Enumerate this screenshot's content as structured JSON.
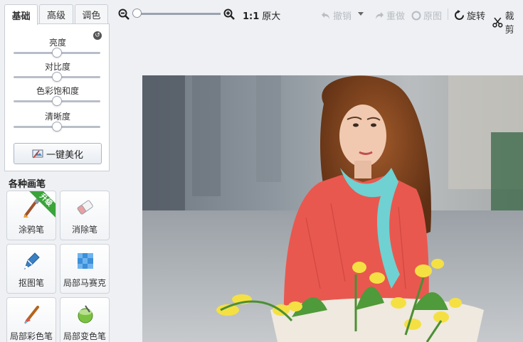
{
  "tabs": [
    {
      "label": "基础",
      "active": true
    },
    {
      "label": "高级",
      "active": false
    },
    {
      "label": "调色",
      "active": false
    }
  ],
  "adjustments": [
    {
      "label": "亮度",
      "value": 0.5
    },
    {
      "label": "对比度",
      "value": 0.5
    },
    {
      "label": "色彩饱和度",
      "value": 0.5
    },
    {
      "label": "清晰度",
      "value": 0.5
    }
  ],
  "beautify_button": "一键美化",
  "brushes": {
    "title": "各种画笔",
    "items": [
      {
        "label": "涂鸦笔",
        "icon": "brush-icon",
        "badge": "升级"
      },
      {
        "label": "消除笔",
        "icon": "eraser-icon"
      },
      {
        "label": "抠图笔",
        "icon": "cutout-pen-icon"
      },
      {
        "label": "局部马赛克",
        "icon": "mosaic-icon"
      },
      {
        "label": "局部彩色笔",
        "icon": "color-brush-icon"
      },
      {
        "label": "局部变色笔",
        "icon": "recolor-icon"
      }
    ]
  },
  "toolbar": {
    "zoom_ratio": "1:1",
    "original_size": "原大",
    "undo": "撤销",
    "redo": "重做",
    "original": "原图",
    "rotate": "旋转",
    "crop": "裁剪"
  },
  "colors": {
    "accent_ribbon": "#3aa43a",
    "disabled_text": "#b8bcc2",
    "panel_border": "#c9ced6"
  }
}
